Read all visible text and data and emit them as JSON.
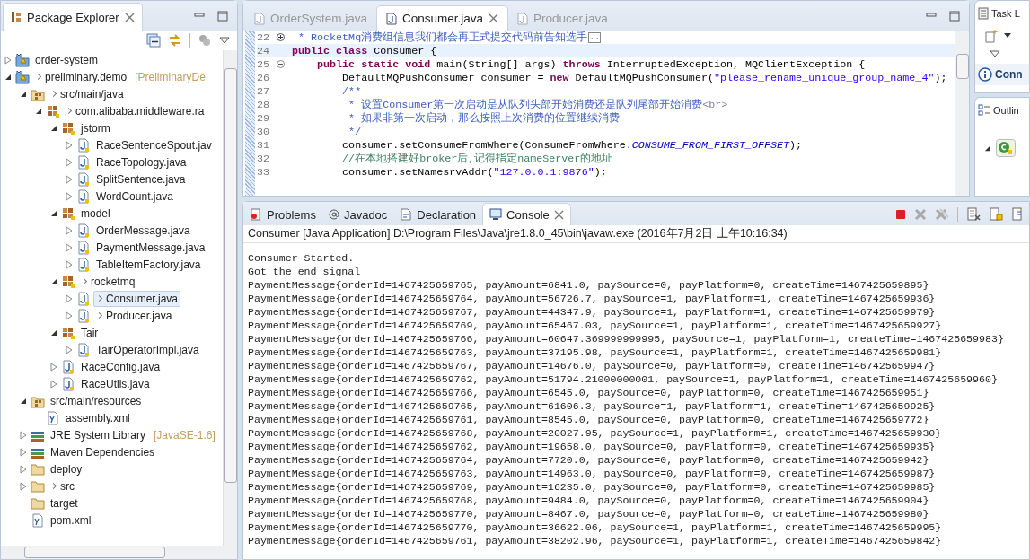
{
  "explorer": {
    "title": "Package Explorer",
    "items": [
      {
        "label": "order-system",
        "kind": "project",
        "dirty": false,
        "expanded": false,
        "selected": false
      },
      {
        "label": "preliminary.demo",
        "kind": "project",
        "dirty": true,
        "suffix": "[PreliminaryDe",
        "expanded": true,
        "selected": false,
        "children": [
          {
            "label": "src/main/java",
            "kind": "srcfolder",
            "dirty": true,
            "expanded": true,
            "selected": false,
            "children": [
              {
                "label": "com.alibaba.middleware.ra",
                "kind": "package",
                "dirty": true,
                "expanded": true,
                "selected": false,
                "children": [
                  {
                    "label": "jstorm",
                    "kind": "package",
                    "dirty": false,
                    "expanded": true,
                    "selected": false,
                    "children": [
                      {
                        "label": "RaceSentenceSpout.jav",
                        "kind": "java",
                        "dirty": false,
                        "expanded": false,
                        "selected": false
                      },
                      {
                        "label": "RaceTopology.java",
                        "kind": "java",
                        "dirty": false,
                        "expanded": false,
                        "selected": false
                      },
                      {
                        "label": "SplitSentence.java",
                        "kind": "java",
                        "dirty": false,
                        "expanded": false,
                        "selected": false
                      },
                      {
                        "label": "WordCount.java",
                        "kind": "java",
                        "dirty": false,
                        "expanded": false,
                        "selected": false
                      }
                    ]
                  },
                  {
                    "label": "model",
                    "kind": "package",
                    "dirty": false,
                    "expanded": true,
                    "selected": false,
                    "children": [
                      {
                        "label": "OrderMessage.java",
                        "kind": "java",
                        "dirty": false,
                        "expanded": false,
                        "selected": false
                      },
                      {
                        "label": "PaymentMessage.java",
                        "kind": "java",
                        "dirty": false,
                        "expanded": false,
                        "selected": false
                      },
                      {
                        "label": "TableItemFactory.java",
                        "kind": "java",
                        "dirty": false,
                        "expanded": false,
                        "selected": false
                      }
                    ]
                  },
                  {
                    "label": "rocketmq",
                    "kind": "package",
                    "dirty": true,
                    "expanded": true,
                    "selected": false,
                    "children": [
                      {
                        "label": "Consumer.java",
                        "kind": "java",
                        "dirty": true,
                        "expanded": false,
                        "selected": true
                      },
                      {
                        "label": "Producer.java",
                        "kind": "java",
                        "dirty": true,
                        "expanded": false,
                        "selected": false
                      }
                    ]
                  },
                  {
                    "label": "Tair",
                    "kind": "package",
                    "dirty": false,
                    "expanded": true,
                    "selected": false,
                    "children": [
                      {
                        "label": "TairOperatorImpl.java",
                        "kind": "java",
                        "dirty": false,
                        "expanded": false,
                        "selected": false
                      }
                    ]
                  },
                  {
                    "label": "RaceConfig.java",
                    "kind": "java",
                    "dirty": false,
                    "expanded": false,
                    "selected": false
                  },
                  {
                    "label": "RaceUtils.java",
                    "kind": "java",
                    "dirty": false,
                    "expanded": false,
                    "selected": false
                  }
                ]
              }
            ]
          },
          {
            "label": "src/main/resources",
            "kind": "srcfolder",
            "dirty": false,
            "expanded": true,
            "selected": false,
            "children": [
              {
                "label": "assembly.xml",
                "kind": "xml",
                "dirty": false,
                "selected": false
              }
            ]
          },
          {
            "label": "JRE System Library",
            "kind": "library",
            "dirty": false,
            "suffix": "[JavaSE-1.6]",
            "expanded": false,
            "selected": false
          },
          {
            "label": "Maven Dependencies",
            "kind": "library",
            "dirty": false,
            "expanded": false,
            "selected": false
          },
          {
            "label": "deploy",
            "kind": "folder",
            "dirty": false,
            "expanded": false,
            "selected": false
          },
          {
            "label": "src",
            "kind": "folder",
            "dirty": true,
            "expanded": false,
            "selected": false
          },
          {
            "label": "target",
            "kind": "folder",
            "dirty": false,
            "selected": false
          },
          {
            "label": "pom.xml",
            "kind": "xml",
            "dirty": false,
            "selected": false
          }
        ]
      }
    ]
  },
  "editor": {
    "tabs": [
      {
        "label": "OrderSystem.java",
        "selected": false
      },
      {
        "label": "Consumer.java",
        "selected": true
      },
      {
        "label": "Producer.java",
        "selected": false
      }
    ],
    "lines": [
      {
        "number": "22",
        "kind": "folded",
        "current": false,
        "segments": [
          {
            "kind": "javadoc",
            "text": " * RocketMq消费组信息我们都会再正式提交代码前告知选手"
          },
          {
            "kind": "foldbox",
            "text": ".."
          }
        ]
      },
      {
        "number": "24",
        "kind": "plain",
        "current": true,
        "segments": [
          {
            "kind": "kw",
            "text": "public class"
          },
          {
            "kind": "plain",
            "text": " Consumer {"
          }
        ]
      },
      {
        "number": "25",
        "kind": "fold_start",
        "current": false,
        "segments": [
          {
            "kind": "kw",
            "text": "    public static void"
          },
          {
            "kind": "plain",
            "text": " main(String[] args) "
          },
          {
            "kind": "kw",
            "text": "throws"
          },
          {
            "kind": "plain",
            "text": " InterruptedException, MQClientException {"
          }
        ]
      },
      {
        "number": "26",
        "kind": "plain",
        "current": false,
        "segments": [
          {
            "kind": "plain",
            "text": "        DefaultMQPushConsumer consumer = "
          },
          {
            "kind": "kw",
            "text": "new"
          },
          {
            "kind": "plain",
            "text": " DefaultMQPushConsumer("
          },
          {
            "kind": "str",
            "text": "\"please_rename_unique_group_name_4\""
          },
          {
            "kind": "plain",
            "text": ");"
          }
        ]
      },
      {
        "number": "27",
        "kind": "plain",
        "current": false,
        "segments": [
          {
            "kind": "javadoc",
            "text": "        /**"
          }
        ]
      },
      {
        "number": "28",
        "kind": "plain",
        "current": false,
        "segments": [
          {
            "kind": "javadoc",
            "text": "         * 设置Consumer第一次启动是从队列头部开始消费还是队列尾部开始消费"
          },
          {
            "kind": "tag",
            "text": "<br>"
          }
        ]
      },
      {
        "number": "29",
        "kind": "plain",
        "current": false,
        "segments": [
          {
            "kind": "javadoc",
            "text": "         * 如果非第一次启动，那么按照上次消费的位置继续消费"
          }
        ]
      },
      {
        "number": "30",
        "kind": "plain",
        "current": false,
        "segments": [
          {
            "kind": "javadoc",
            "text": "         */"
          }
        ]
      },
      {
        "number": "31",
        "kind": "plain",
        "current": false,
        "segments": [
          {
            "kind": "plain",
            "text": "        consumer.setConsumeFromWhere(ConsumeFromWhere."
          },
          {
            "kind": "const",
            "text": "CONSUME_FROM_FIRST_OFFSET"
          },
          {
            "kind": "plain",
            "text": ");"
          }
        ]
      },
      {
        "number": "32",
        "kind": "plain",
        "current": false,
        "segments": [
          {
            "kind": "comment",
            "text": "        //在本地搭建好broker后,记得指定nameServer的地址"
          }
        ]
      },
      {
        "number": "33",
        "kind": "plain",
        "current": false,
        "segments": [
          {
            "kind": "plain",
            "text": "        consumer.setNamesrvAddr("
          },
          {
            "kind": "str",
            "text": "\"127.0.0.1:9876\""
          },
          {
            "kind": "plain",
            "text": ");"
          }
        ]
      }
    ]
  },
  "side": {
    "task_title": "Task L",
    "connect_label": "Conn",
    "outline_title": "Outlin"
  },
  "console": {
    "tabs": [
      {
        "label": "Problems",
        "kind": "problems",
        "selected": false
      },
      {
        "label": "Javadoc",
        "kind": "javadoc",
        "selected": false
      },
      {
        "label": "Declaration",
        "kind": "declaration",
        "selected": false
      },
      {
        "label": "Console",
        "kind": "console",
        "selected": true
      }
    ],
    "header": "Consumer [Java Application] D:\\Program Files\\Java\\jre1.8.0_45\\bin\\javaw.exe (2016年7月2日 上午10:16:34)",
    "lines": [
      "Consumer Started.",
      "Got the end signal",
      "PaymentMessage{orderId=1467425659765, payAmount=6841.0, paySource=0, payPlatform=0, createTime=1467425659895}",
      "PaymentMessage{orderId=1467425659764, payAmount=56726.7, paySource=1, payPlatform=1, createTime=1467425659936}",
      "PaymentMessage{orderId=1467425659767, payAmount=44347.9, paySource=1, payPlatform=1, createTime=1467425659979}",
      "PaymentMessage{orderId=1467425659769, payAmount=65467.03, paySource=1, payPlatform=1, createTime=1467425659927}",
      "PaymentMessage{orderId=1467425659766, payAmount=60647.369999999995, paySource=1, payPlatform=1, createTime=1467425659983}",
      "PaymentMessage{orderId=1467425659763, payAmount=37195.98, paySource=1, payPlatform=1, createTime=1467425659981}",
      "PaymentMessage{orderId=1467425659767, payAmount=14676.0, paySource=0, payPlatform=0, createTime=1467425659947}",
      "PaymentMessage{orderId=1467425659762, payAmount=51794.21000000001, paySource=1, payPlatform=1, createTime=1467425659960}",
      "PaymentMessage{orderId=1467425659766, payAmount=6545.0, paySource=0, payPlatform=0, createTime=1467425659951}",
      "PaymentMessage{orderId=1467425659765, payAmount=61606.3, paySource=1, payPlatform=1, createTime=1467425659925}",
      "PaymentMessage{orderId=1467425659761, payAmount=8545.0, paySource=0, payPlatform=0, createTime=1467425659772}",
      "PaymentMessage{orderId=1467425659768, payAmount=20027.95, paySource=1, payPlatform=1, createTime=1467425659930}",
      "PaymentMessage{orderId=1467425659762, payAmount=19658.0, paySource=0, payPlatform=0, createTime=1467425659935}",
      "PaymentMessage{orderId=1467425659764, payAmount=7720.0, paySource=0, payPlatform=0, createTime=1467425659942}",
      "PaymentMessage{orderId=1467425659763, payAmount=14963.0, paySource=0, payPlatform=0, createTime=1467425659987}",
      "PaymentMessage{orderId=1467425659769, payAmount=16235.0, paySource=0, payPlatform=0, createTime=1467425659985}",
      "PaymentMessage{orderId=1467425659768, payAmount=9484.0, paySource=0, payPlatform=0, createTime=1467425659904}",
      "PaymentMessage{orderId=1467425659770, payAmount=8467.0, paySource=0, payPlatform=0, createTime=1467425659980}",
      "PaymentMessage{orderId=1467425659770, payAmount=36622.06, paySource=1, payPlatform=1, createTime=1467425659995}",
      "PaymentMessage{orderId=1467425659761, payAmount=38202.96, paySource=1, payPlatform=1, createTime=1467425659842}"
    ]
  }
}
